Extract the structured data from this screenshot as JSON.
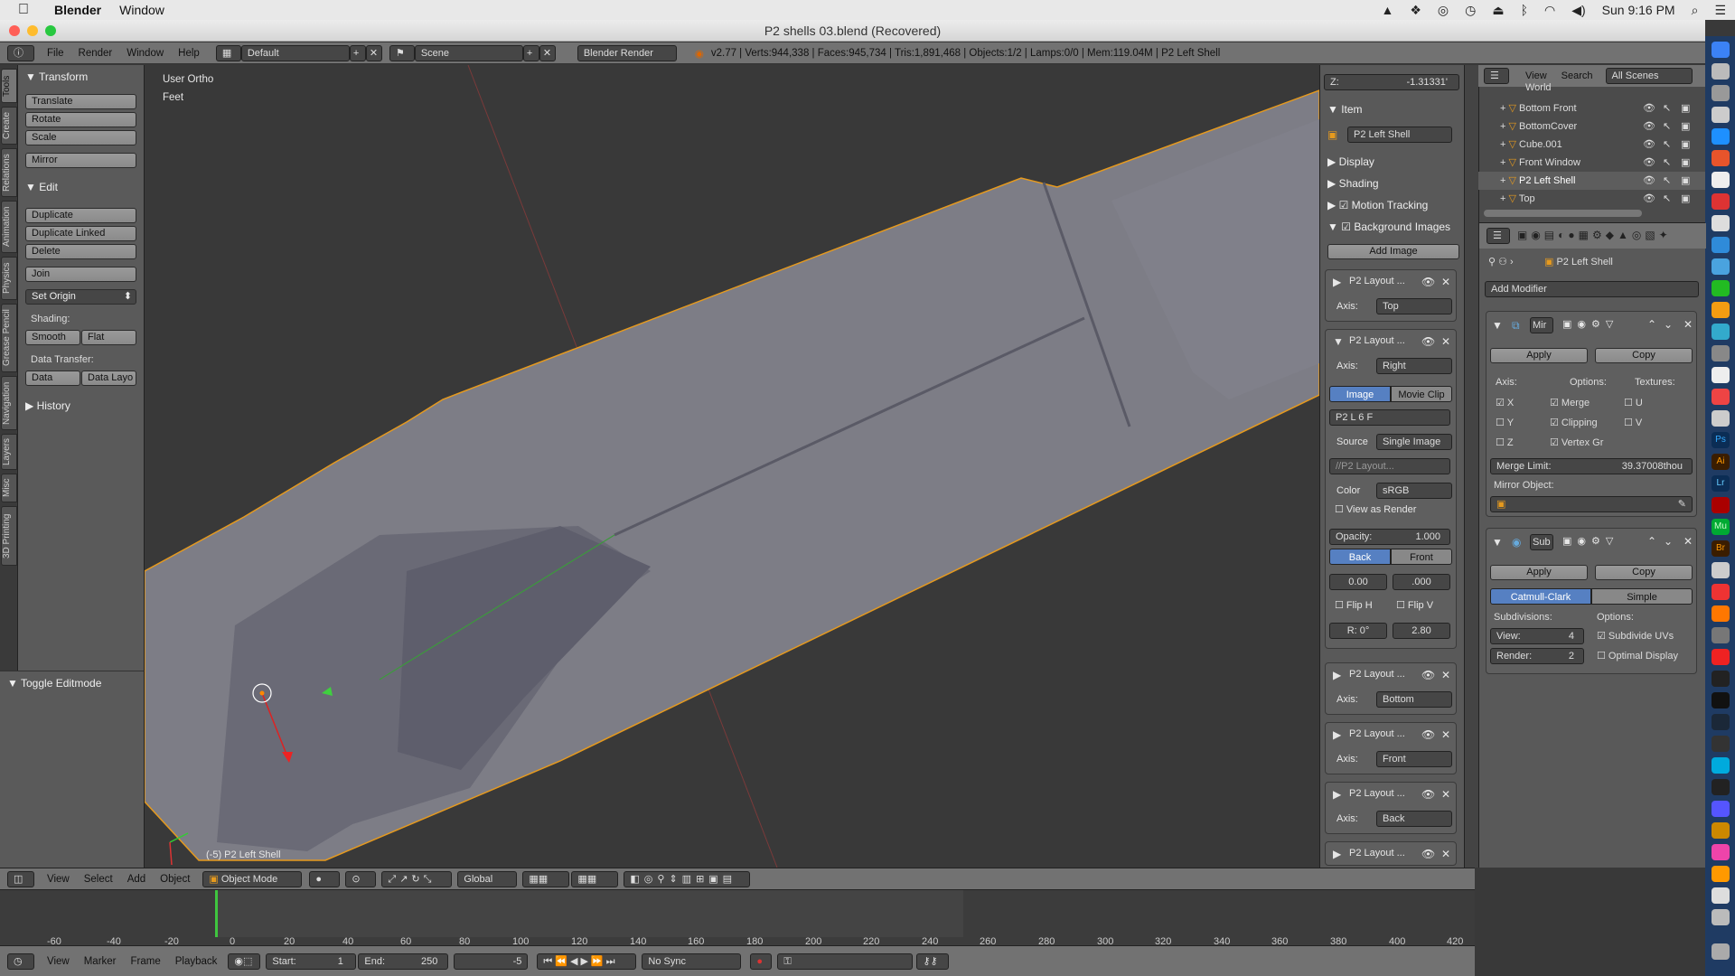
{
  "mac_menubar": {
    "app": "Blender",
    "menu_window": "Window",
    "clock": "Sun 9:16 PM"
  },
  "window": {
    "title": "P2 shells 03.blend (Recovered)"
  },
  "info_header": {
    "menus": [
      "File",
      "Render",
      "Window",
      "Help"
    ],
    "layout": "Default",
    "scene": "Scene",
    "engine": "Blender Render",
    "stats": "v2.77 | Verts:944,338 | Faces:945,734 | Tris:1,891,468 | Objects:1/2 | Lamps:0/0 | Mem:119.04M | P2 Left Shell"
  },
  "tool_tabs": [
    "Tools",
    "Create",
    "Relations",
    "Animation",
    "Physics",
    "Grease Pencil",
    "Navigation",
    "Layers",
    "Misc",
    "3D Printing"
  ],
  "tool_shelf": {
    "transform": {
      "title": "Transform",
      "buttons": [
        "Translate",
        "Rotate",
        "Scale",
        "Mirror"
      ]
    },
    "edit": {
      "title": "Edit",
      "buttons": [
        "Duplicate",
        "Duplicate Linked",
        "Delete",
        "Join"
      ],
      "set_origin": "Set Origin",
      "shading_label": "Shading:",
      "smooth": "Smooth",
      "flat": "Flat",
      "data_transfer_label": "Data Transfer:",
      "data": "Data",
      "data_layo": "Data Layo"
    },
    "history": "History"
  },
  "operator_panel": {
    "title": "Toggle Editmode"
  },
  "viewport": {
    "view_name": "User Ortho",
    "units": "Feet",
    "object_label": "(-5) P2 Left Shell"
  },
  "npanel": {
    "z_label": "Z:",
    "z_value": "-1.31331'",
    "item_title": "Item",
    "item_name": "P2 Left Shell",
    "display": "Display",
    "shading": "Shading",
    "motion_tracking": "Motion Tracking",
    "background_images": "Background Images",
    "add_image": "Add Image",
    "axis_label": "Axis:",
    "bg_images": [
      {
        "name": "P2 Layout ...",
        "axis": "Top"
      },
      {
        "name": "P2 Layout ...",
        "axis": "Right"
      },
      {
        "name": "P2 Layout ...",
        "axis": "Bottom"
      },
      {
        "name": "P2 Layout ...",
        "axis": "Front"
      },
      {
        "name": "P2 Layout ...",
        "axis": "Back"
      },
      {
        "name": "P2 Layout ...",
        "axis": ""
      }
    ],
    "expanded": {
      "image_tab": "Image",
      "movie_clip_tab": "Movie Clip",
      "image_name": "P2 L",
      "users": "6",
      "fake": "F",
      "source_label": "Source",
      "source_value": "Single Image",
      "filepath": "//P2 Layout...",
      "color_label": "Color",
      "color_value": "sRGB",
      "view_as_render": "View as Render",
      "opacity": "Opacity:",
      "opacity_value": "1.000",
      "back": "Back",
      "front": "Front",
      "x_offset": "0.00",
      "y_offset": ".000",
      "flip_h": "Flip H",
      "flip_v": "Flip V",
      "rotation": "R: 0°",
      "size": "2.80"
    }
  },
  "outliner": {
    "view": "View",
    "search": "Search",
    "filter": "All Scenes",
    "items": [
      "World",
      "Bottom Front",
      "BottomCover",
      "Cube.001",
      "Front Window",
      "P2 Left Shell",
      "Top"
    ],
    "selected": "P2 Left Shell"
  },
  "properties": {
    "context_object": "P2 Left Shell",
    "add_modifier": "Add Modifier",
    "mirror": {
      "name": "Mir",
      "apply": "Apply",
      "copy": "Copy",
      "axis_label": "Axis:",
      "options_label": "Options:",
      "textures_label": "Textures:",
      "axes": [
        {
          "label": "X",
          "checked": true
        },
        {
          "label": "Y",
          "checked": false
        },
        {
          "label": "Z",
          "checked": false
        }
      ],
      "options": [
        {
          "label": "Merge",
          "checked": true
        },
        {
          "label": "Clipping",
          "checked": true
        },
        {
          "label": "Vertex Gr",
          "checked": true
        }
      ],
      "textures": [
        {
          "label": "U",
          "checked": false
        },
        {
          "label": "V",
          "checked": false
        }
      ],
      "merge_limit_label": "Merge Limit:",
      "merge_limit_value": "39.37008thou",
      "mirror_object_label": "Mirror Object:"
    },
    "subsurf": {
      "name": "Sub",
      "apply": "Apply",
      "copy": "Copy",
      "catmull": "Catmull-Clark",
      "simple": "Simple",
      "subdivisions_label": "Subdivisions:",
      "options_label": "Options:",
      "view_label": "View:",
      "view_value": "4",
      "render_label": "Render:",
      "render_value": "2",
      "subdivide_uvs": "Subdivide UVs",
      "optimal_display": "Optimal Display"
    }
  },
  "view3d_header": {
    "menus": [
      "View",
      "Select",
      "Add",
      "Object"
    ],
    "mode": "Object Mode",
    "orientation": "Global"
  },
  "timeline": {
    "ticks": [
      "-60",
      "-40",
      "-20",
      "0",
      "20",
      "40",
      "60",
      "80",
      "100",
      "120",
      "140",
      "160",
      "180",
      "200",
      "220",
      "240",
      "260",
      "280",
      "300",
      "320",
      "340",
      "360",
      "380",
      "400",
      "420"
    ],
    "current_frame_marker": 0
  },
  "timeline_header": {
    "menus": [
      "View",
      "Marker",
      "Frame",
      "Playback"
    ],
    "start_label": "Start:",
    "start_value": "1",
    "end_label": "End:",
    "end_value": "250",
    "current": "-5",
    "sync": "No Sync"
  },
  "colors": {
    "selection_orange": "#e69a1e",
    "active_blue": "#5680c2",
    "mesh_gray": "#8a8a94"
  }
}
